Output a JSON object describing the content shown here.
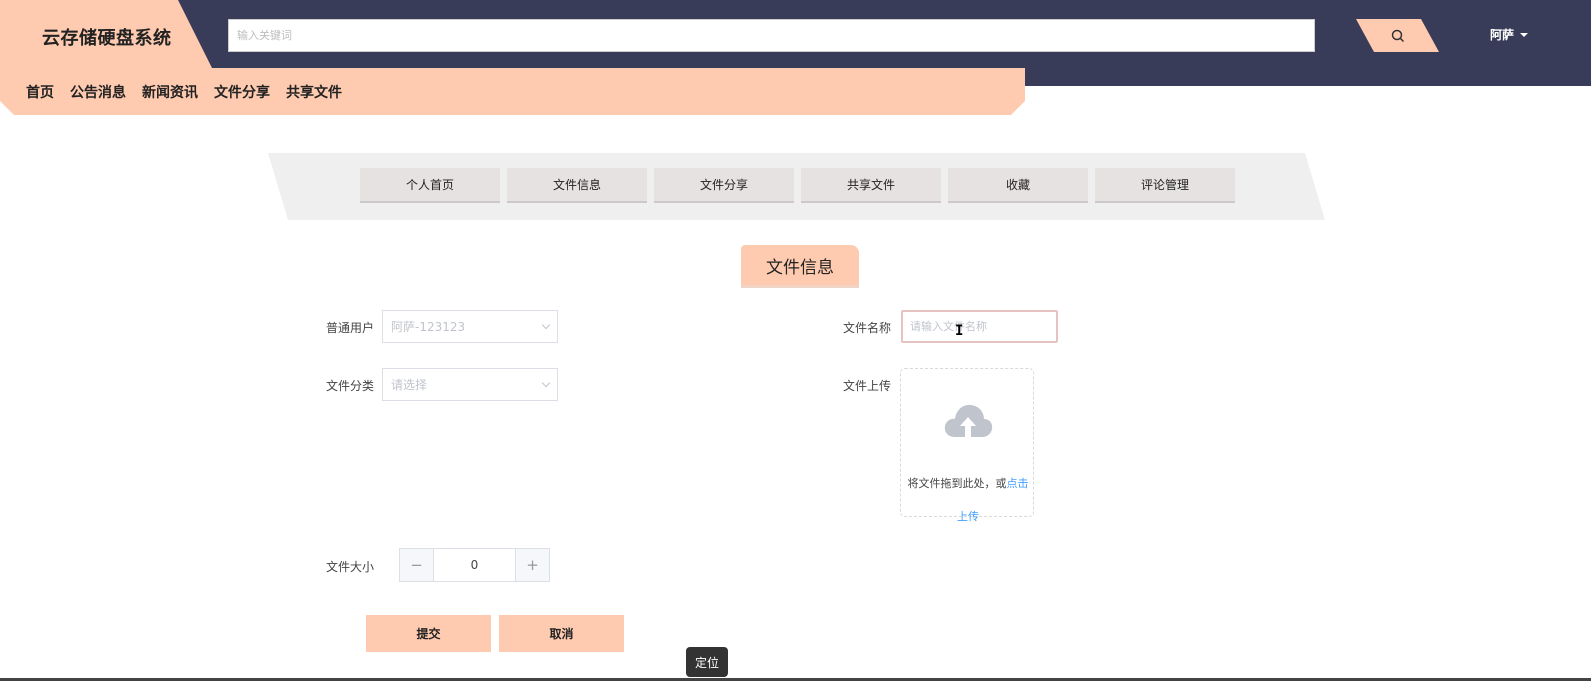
{
  "header": {
    "logo": "云存储硬盘系统",
    "search_placeholder": "输入关键词",
    "user_name": "阿萨"
  },
  "nav": [
    "首页",
    "公告消息",
    "新闻资讯",
    "文件分享",
    "共享文件"
  ],
  "tabs": [
    "个人首页",
    "文件信息",
    "文件分享",
    "共享文件",
    "收藏",
    "评论管理"
  ],
  "form": {
    "title": "文件信息",
    "user_label": "普通用户",
    "user_value": "阿萨-123123",
    "category_label": "文件分类",
    "category_placeholder": "请选择",
    "filename_label": "文件名称",
    "filename_placeholder": "请输入文件名称",
    "upload_label": "文件上传",
    "upload_text": "将文件拖到此处，或",
    "upload_link_1": "点击",
    "upload_link_2": "上传",
    "size_label": "文件大小",
    "size_value": "0",
    "submit": "提交",
    "cancel": "取消"
  },
  "tooltip": "定位",
  "colors": {
    "header_bg": "#393c59",
    "accent": "#ffcbb0"
  }
}
